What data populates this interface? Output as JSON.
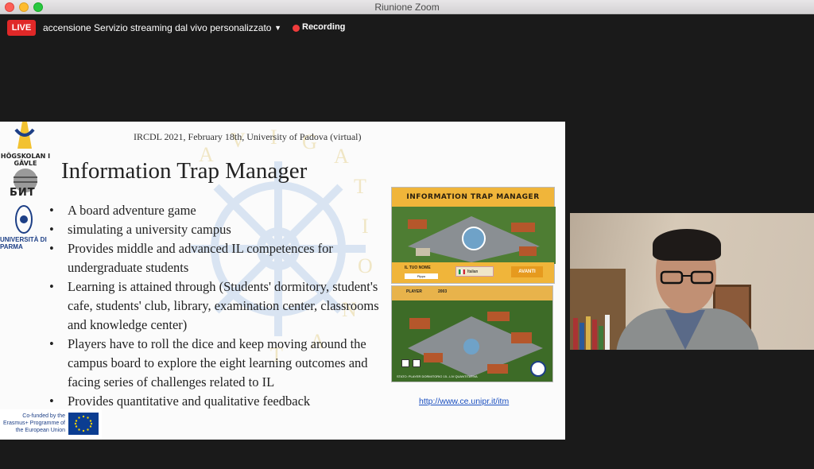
{
  "window": {
    "title": "Riunione Zoom"
  },
  "topbar": {
    "live_label": "LIVE",
    "stream_service": "accensione Servizio streaming dal vivo personalizzato",
    "recording_label": "Recording"
  },
  "slide": {
    "header": "IRCDL 2021, February 18th, University of Padova (virtual)",
    "title": "Information Trap Manager",
    "bullets": [
      "A board adventure game",
      "simulating a university campus",
      "Provides middle and advanced IL competences for undergraduate students",
      "Learning is attained through (Students' dormitory, student's cafe, students' club, library, examination center,  classrooms and knowledge center)",
      "Players have to roll the dice and keep moving around the campus board to explore the eight learning outcomes and facing series of challenges related to IL",
      "Provides quantitative and qualitative feedback"
    ],
    "logos": {
      "hig": "HÖGSKOLAN I GÄVLE",
      "bnt": "БИТ",
      "parma": "UNIVERSITÀ DI PARMA",
      "erasmus": "Co-funded by the Erasmus+ Programme of the European Union"
    },
    "game": {
      "title": "INFORMATION TRAP MANAGER",
      "name_label": "IL TUO NOME",
      "name_value": "Pippo",
      "language": "Italian",
      "next_button": "AVANTI",
      "player_label": "PLAYER",
      "year": "2003",
      "status_text": "STATO: PLAYER DORMITORIO  15...LIV QUANTITATIVA"
    },
    "url": "http://www.ce.unipr.it/itm"
  },
  "colors": {
    "live_red": "#e02828",
    "link_blue": "#1a4fc0",
    "game_orange": "#f0b53a"
  }
}
